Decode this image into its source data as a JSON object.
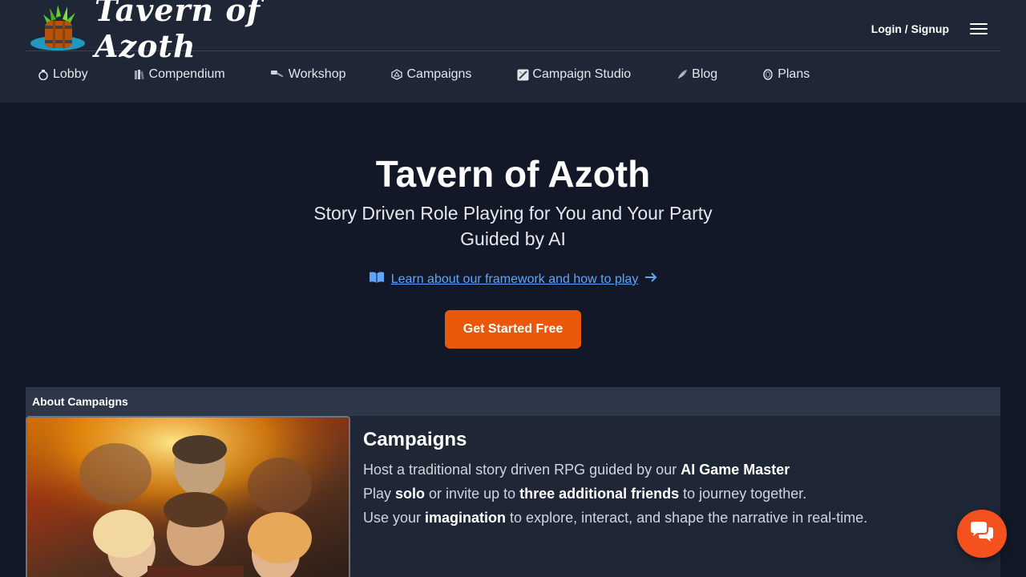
{
  "header": {
    "logo_text": "Tavern of Azoth",
    "login_label": "Login / Signup"
  },
  "nav": {
    "items": [
      {
        "label": "Lobby",
        "icon": "potion-icon"
      },
      {
        "label": "Compendium",
        "icon": "books-icon"
      },
      {
        "label": "Workshop",
        "icon": "hammer-icon"
      },
      {
        "label": "Campaigns",
        "icon": "d20-icon"
      },
      {
        "label": "Campaign Studio",
        "icon": "quill-sword-icon"
      },
      {
        "label": "Blog",
        "icon": "feather-icon"
      },
      {
        "label": "Plans",
        "icon": "coin-icon"
      }
    ]
  },
  "hero": {
    "title": "Tavern of Azoth",
    "subtitle_line1": "Story Driven Role Playing for You and Your Party",
    "subtitle_line2": "Guided by AI",
    "learn_link": "Learn about our framework and how to play",
    "cta_label": "Get Started Free"
  },
  "about": {
    "header": "About Campaigns",
    "title": "Campaigns",
    "line1_a": "Host a traditional story driven RPG guided by our ",
    "line1_b": "AI Game Master",
    "line2_a": "Play ",
    "line2_b": "solo",
    "line2_c": " or invite up to ",
    "line2_d": "three additional friends",
    "line2_e": " to journey together.",
    "line3_a": "Use your ",
    "line3_b": "imagination",
    "line3_c": " to explore, interact, and shape the narrative in real-time."
  },
  "colors": {
    "accent": "#ea580c",
    "link": "#60a5fa",
    "chat": "#f4511e",
    "background": "#121827"
  }
}
